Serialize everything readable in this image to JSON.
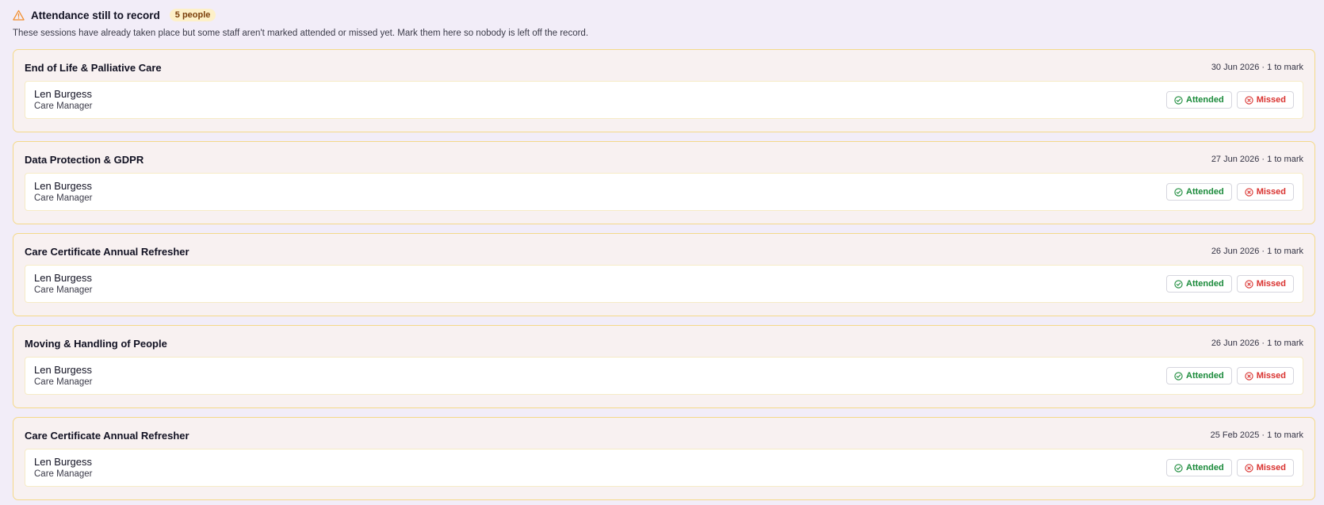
{
  "header": {
    "title": "Attendance still to record",
    "badge": "5 people",
    "subtitle": "These sessions have already taken place but some staff aren't marked attended or missed yet. Mark them here so nobody is left off the record.",
    "icon": "warning-triangle-icon"
  },
  "colors": {
    "accent_warning": "#f28c28",
    "attended": "#1a8a3a",
    "missed": "#d9322f",
    "card_border": "#f4d98a"
  },
  "buttons": {
    "attended_label": "Attended",
    "missed_label": "Missed"
  },
  "sessions": [
    {
      "title": "End of Life & Palliative Care",
      "meta": "30 Jun 2026 · 1 to mark",
      "attendee": {
        "name": "Len Burgess",
        "role": "Care Manager"
      }
    },
    {
      "title": "Data Protection & GDPR",
      "meta": "27 Jun 2026 · 1 to mark",
      "attendee": {
        "name": "Len Burgess",
        "role": "Care Manager"
      }
    },
    {
      "title": "Care Certificate Annual Refresher",
      "meta": "26 Jun 2026 · 1 to mark",
      "attendee": {
        "name": "Len Burgess",
        "role": "Care Manager"
      }
    },
    {
      "title": "Moving & Handling of People",
      "meta": "26 Jun 2026 · 1 to mark",
      "attendee": {
        "name": "Len Burgess",
        "role": "Care Manager"
      }
    },
    {
      "title": "Care Certificate Annual Refresher",
      "meta": "25 Feb 2025 · 1 to mark",
      "attendee": {
        "name": "Len Burgess",
        "role": "Care Manager"
      }
    }
  ]
}
